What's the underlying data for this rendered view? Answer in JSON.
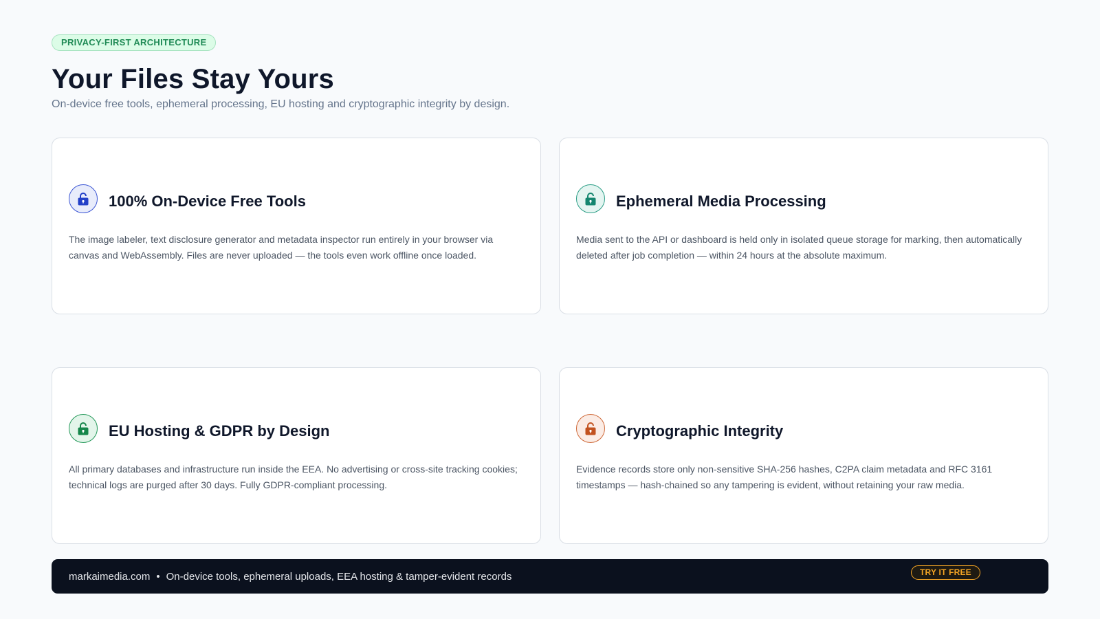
{
  "header": {
    "badge": "PRIVACY-FIRST ARCHITECTURE",
    "title": "Your Files Stay Yours",
    "subtitle": "On-device free tools, ephemeral processing, EU hosting and cryptographic integrity by design."
  },
  "cards": [
    {
      "title": "100% On-Device Free Tools",
      "body": "The image labeler, text disclosure generator and metadata inspector run entirely in your browser via canvas and WebAssembly. Files are never uploaded — the tools even work offline once loaded.",
      "icon": "lock-icon",
      "accent": "#2340c8"
    },
    {
      "title": "Ephemeral Media Processing",
      "body": "Media sent to the API or dashboard is held only in isolated queue storage for marking, then automatically deleted after job completion — within 24 hours at the absolute maximum.",
      "icon": "lock-icon",
      "accent": "#14866f"
    },
    {
      "title": "EU Hosting & GDPR by Design",
      "body": "All primary databases and infrastructure run inside the EEA. No advertising or cross-site tracking cookies; technical logs are purged after 30 days. Fully GDPR-compliant processing.",
      "icon": "lock-icon",
      "accent": "#15864a"
    },
    {
      "title": "Cryptographic Integrity",
      "body": "Evidence records store only non-sensitive SHA-256 hashes, C2PA claim metadata and RFC 3161 timestamps — hash-chained so any tampering is evident, without retaining your raw media.",
      "icon": "lock-icon",
      "accent": "#c2521f"
    }
  ],
  "footer": {
    "domain": "markaimedia.com",
    "separator": "•",
    "tagline": "On-device tools, ephemeral uploads, EEA hosting & tamper-evident records",
    "cta": "TRY IT FREE"
  },
  "colors": {
    "background": "#f8fafc",
    "footer_bg": "#0b111e",
    "cta": "#f5a524",
    "badge_text": "#1f8a55"
  }
}
